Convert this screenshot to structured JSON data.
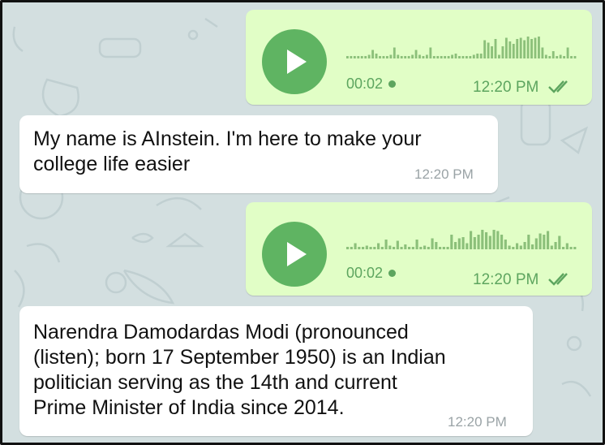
{
  "messages": [
    {
      "type": "voice",
      "direction": "outgoing",
      "duration": "00:02",
      "time": "12:20 PM",
      "status": "read",
      "waveform": [
        2,
        2,
        2,
        2,
        2,
        2,
        3,
        7,
        4,
        2,
        2,
        2,
        3,
        9,
        3,
        2,
        2,
        2,
        3,
        7,
        3,
        2,
        3,
        9,
        2,
        2,
        2,
        2,
        2,
        3,
        4,
        2,
        2,
        2,
        2,
        3,
        4,
        4,
        15,
        13,
        10,
        16,
        3,
        10,
        17,
        14,
        12,
        16,
        17,
        15,
        18,
        16,
        17,
        18,
        9,
        3,
        2,
        6,
        2,
        3,
        2,
        9,
        2,
        2
      ]
    },
    {
      "type": "text",
      "direction": "incoming",
      "lines": [
        "My name is AInstein. I'm here to make your",
        "college life easier"
      ],
      "time": "12:20 PM"
    },
    {
      "type": "voice",
      "direction": "outgoing",
      "duration": "00:02",
      "time": "12:20 PM",
      "status": "read",
      "waveform": [
        2,
        2,
        5,
        2,
        2,
        3,
        2,
        2,
        5,
        2,
        8,
        3,
        2,
        7,
        2,
        4,
        2,
        2,
        8,
        2,
        3,
        2,
        9,
        6,
        2,
        2,
        2,
        12,
        6,
        9,
        10,
        5,
        15,
        10,
        12,
        16,
        14,
        11,
        16,
        15,
        12,
        8,
        3,
        2,
        5,
        3,
        6,
        12,
        4,
        9,
        13,
        12,
        15,
        3,
        6,
        11,
        2,
        5,
        2,
        2
      ]
    },
    {
      "type": "text",
      "direction": "incoming",
      "lines": [
        "Narendra Damodardas Modi (pronounced",
        "(listen); born 17 September 1950) is an Indian",
        "politician serving as the 14th and current",
        "Prime Minister of India since 2014."
      ],
      "time": "12:20 PM"
    }
  ],
  "colors": {
    "wallpaper": "#d3dfe0",
    "outgoing_bubble": "#e1fec6",
    "incoming_bubble": "#ffffff",
    "accent": "#5fb462",
    "meta_incoming": "#9aa3a6"
  }
}
